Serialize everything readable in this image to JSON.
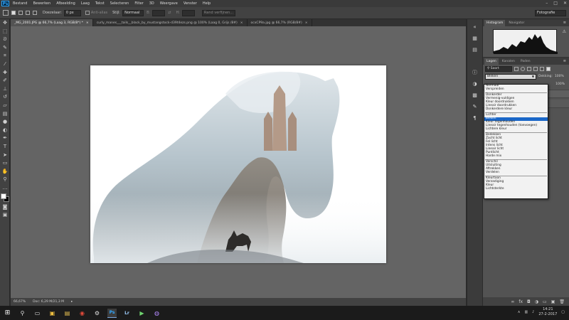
{
  "app": {
    "logo_text": "Ps",
    "menu": [
      "Bestand",
      "Bewerken",
      "Afbeelding",
      "Laag",
      "Tekst",
      "Selecteren",
      "Filter",
      "3D",
      "Weergave",
      "Venster",
      "Help"
    ],
    "window_controls": [
      "–",
      "□",
      "✕"
    ]
  },
  "options_bar": {
    "feather_label": "Doezelaar:",
    "feather_value": "0 px",
    "antialias_label": "Anti-alias",
    "style_label": "Stijl:",
    "style_value": "Normaal",
    "width_label": "B:",
    "height_label": "H:",
    "refine_label": "Rand verfijnen...",
    "workspace": "Fotografie"
  },
  "tabs": [
    {
      "label": "_MG_2001.JPG @ 66,7% (Laag 3, RGB/8*) *",
      "active": true
    },
    {
      "label": "curly_manes___tails__black_by_mustangstock-d39t4ezs.png @ 100% (Laag 0, Grijs /8#)",
      "active": false
    },
    {
      "label": "ocxCP9a.jpg @ 66,7% (RGB/8#)",
      "active": false
    }
  ],
  "status": {
    "zoom": "66,67%",
    "doc": "Doc: 6,29 M/21,3 M"
  },
  "panels": {
    "top_tabs": [
      "Histogram",
      "Navigator"
    ],
    "layer_tabs": [
      "Lagen",
      "Kanalen",
      "Paden"
    ],
    "kind_filter": "Soort",
    "blend_mode": "Bleken",
    "opacity_label": "Dekking:",
    "opacity_value": "100%",
    "fill_value": "100%"
  },
  "blend_dropdown": {
    "groups": [
      [
        "Normaal",
        "Verspreiden"
      ],
      [
        "Donkerder",
        "Vermenig-vuldigen",
        "Kleur doordrukken",
        "Lineair doordrukken",
        "Donkerdere kleur"
      ],
      [
        "Lichter",
        "Bleken",
        "Kleur tegenhouden",
        "Lineair tegenhouden (toevoegen)",
        "Lichtere kleur"
      ],
      [
        "Bedekken",
        "Zacht licht",
        "Fel licht",
        "Intens licht",
        "Lineair licht",
        "Puntlicht",
        "Harde mix"
      ],
      [
        "Verschil",
        "Uitsluiting",
        "Aftrekken",
        "Verdelen"
      ],
      [
        "Kleurtoon",
        "Verzadiging",
        "Kleur",
        "Lichtsterkte"
      ]
    ],
    "selected": "Bleken"
  },
  "taskbar": {
    "time": "14:21",
    "date": "27-2-2017"
  }
}
